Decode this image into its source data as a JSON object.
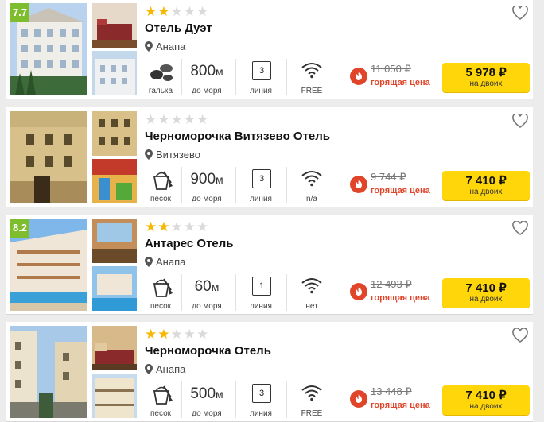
{
  "hotels": [
    {
      "rating": "7.7",
      "stars_filled": 2,
      "name": "Отель Дуэт",
      "location": "Анапа",
      "beach": "галька",
      "beach_icon": "pebbles-icon",
      "distance_value": "800",
      "distance_unit": "м",
      "distance_label": "до моря",
      "line_value": "3",
      "line_label": "линия",
      "wifi_label": "FREE",
      "old_price": "11 050 ₽",
      "hot_label": "горящая цена",
      "price": "5 978 ₽",
      "price_label": "на двоих"
    },
    {
      "rating": "",
      "stars_filled": 0,
      "name": "Черноморочка Витязево Отель",
      "location": "Витязево",
      "beach": "песок",
      "beach_icon": "sand-bucket-icon",
      "distance_value": "900",
      "distance_unit": "м",
      "distance_label": "до моря",
      "line_value": "3",
      "line_label": "линия",
      "wifi_label": "n/a",
      "old_price": "9 744 ₽",
      "hot_label": "горящая цена",
      "price": "7 410 ₽",
      "price_label": "на двоих"
    },
    {
      "rating": "8.2",
      "stars_filled": 2,
      "name": "Антарес Отель",
      "location": "Анапа",
      "beach": "песок",
      "beach_icon": "sand-bucket-icon",
      "distance_value": "60",
      "distance_unit": "м",
      "distance_label": "до моря",
      "line_value": "1",
      "line_label": "линия",
      "wifi_label": "нет",
      "old_price": "12 493 ₽",
      "hot_label": "горящая цена",
      "price": "7 410 ₽",
      "price_label": "на двоих"
    },
    {
      "rating": "",
      "stars_filled": 2,
      "name": "Черноморочка Отель",
      "location": "Анапа",
      "beach": "песок",
      "beach_icon": "sand-bucket-icon",
      "distance_value": "500",
      "distance_unit": "м",
      "distance_label": "до моря",
      "line_value": "3",
      "line_label": "линия",
      "wifi_label": "FREE",
      "old_price": "13 448 ₽",
      "hot_label": "горящая цена",
      "price": "7 410 ₽",
      "price_label": "на двоих"
    }
  ],
  "colors": {
    "rating_badge": "#7ebd2d",
    "star_on": "#f6b800",
    "star_off": "#dadada",
    "price_button": "#ffd60a",
    "hot": "#e0452a"
  }
}
